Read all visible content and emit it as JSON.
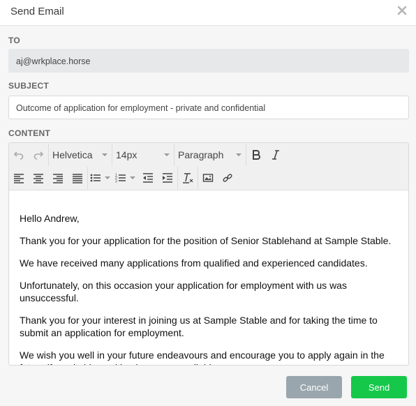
{
  "dialog": {
    "title": "Send Email"
  },
  "to": {
    "label": "TO",
    "value": "aj@wrkplace.horse"
  },
  "subject": {
    "label": "SUBJECT",
    "value": "Outcome of application for employment - private and confidential"
  },
  "content": {
    "label": "CONTENT",
    "toolbar": {
      "font_family": "Helvetica",
      "font_size": "14px",
      "block_format": "Paragraph"
    },
    "paragraphs": [
      "Hello Andrew,",
      "Thank you for your application for the position of Senior Stablehand at Sample Stable.",
      "We have received many applications from qualified and experienced candidates.",
      "Unfortunately, on this occasion your application for employment with us was unsuccessful.",
      "Thank you for your interest in joining us at Sample Stable and for taking the time to submit an application for employment.",
      "We wish you well in your future endeavours and encourage you to apply again in the future if a suitable position becomes available."
    ]
  },
  "footer": {
    "cancel_label": "Cancel",
    "send_label": "Send"
  },
  "colors": {
    "send": "#16c84a",
    "cancel": "#9aa6ad"
  }
}
